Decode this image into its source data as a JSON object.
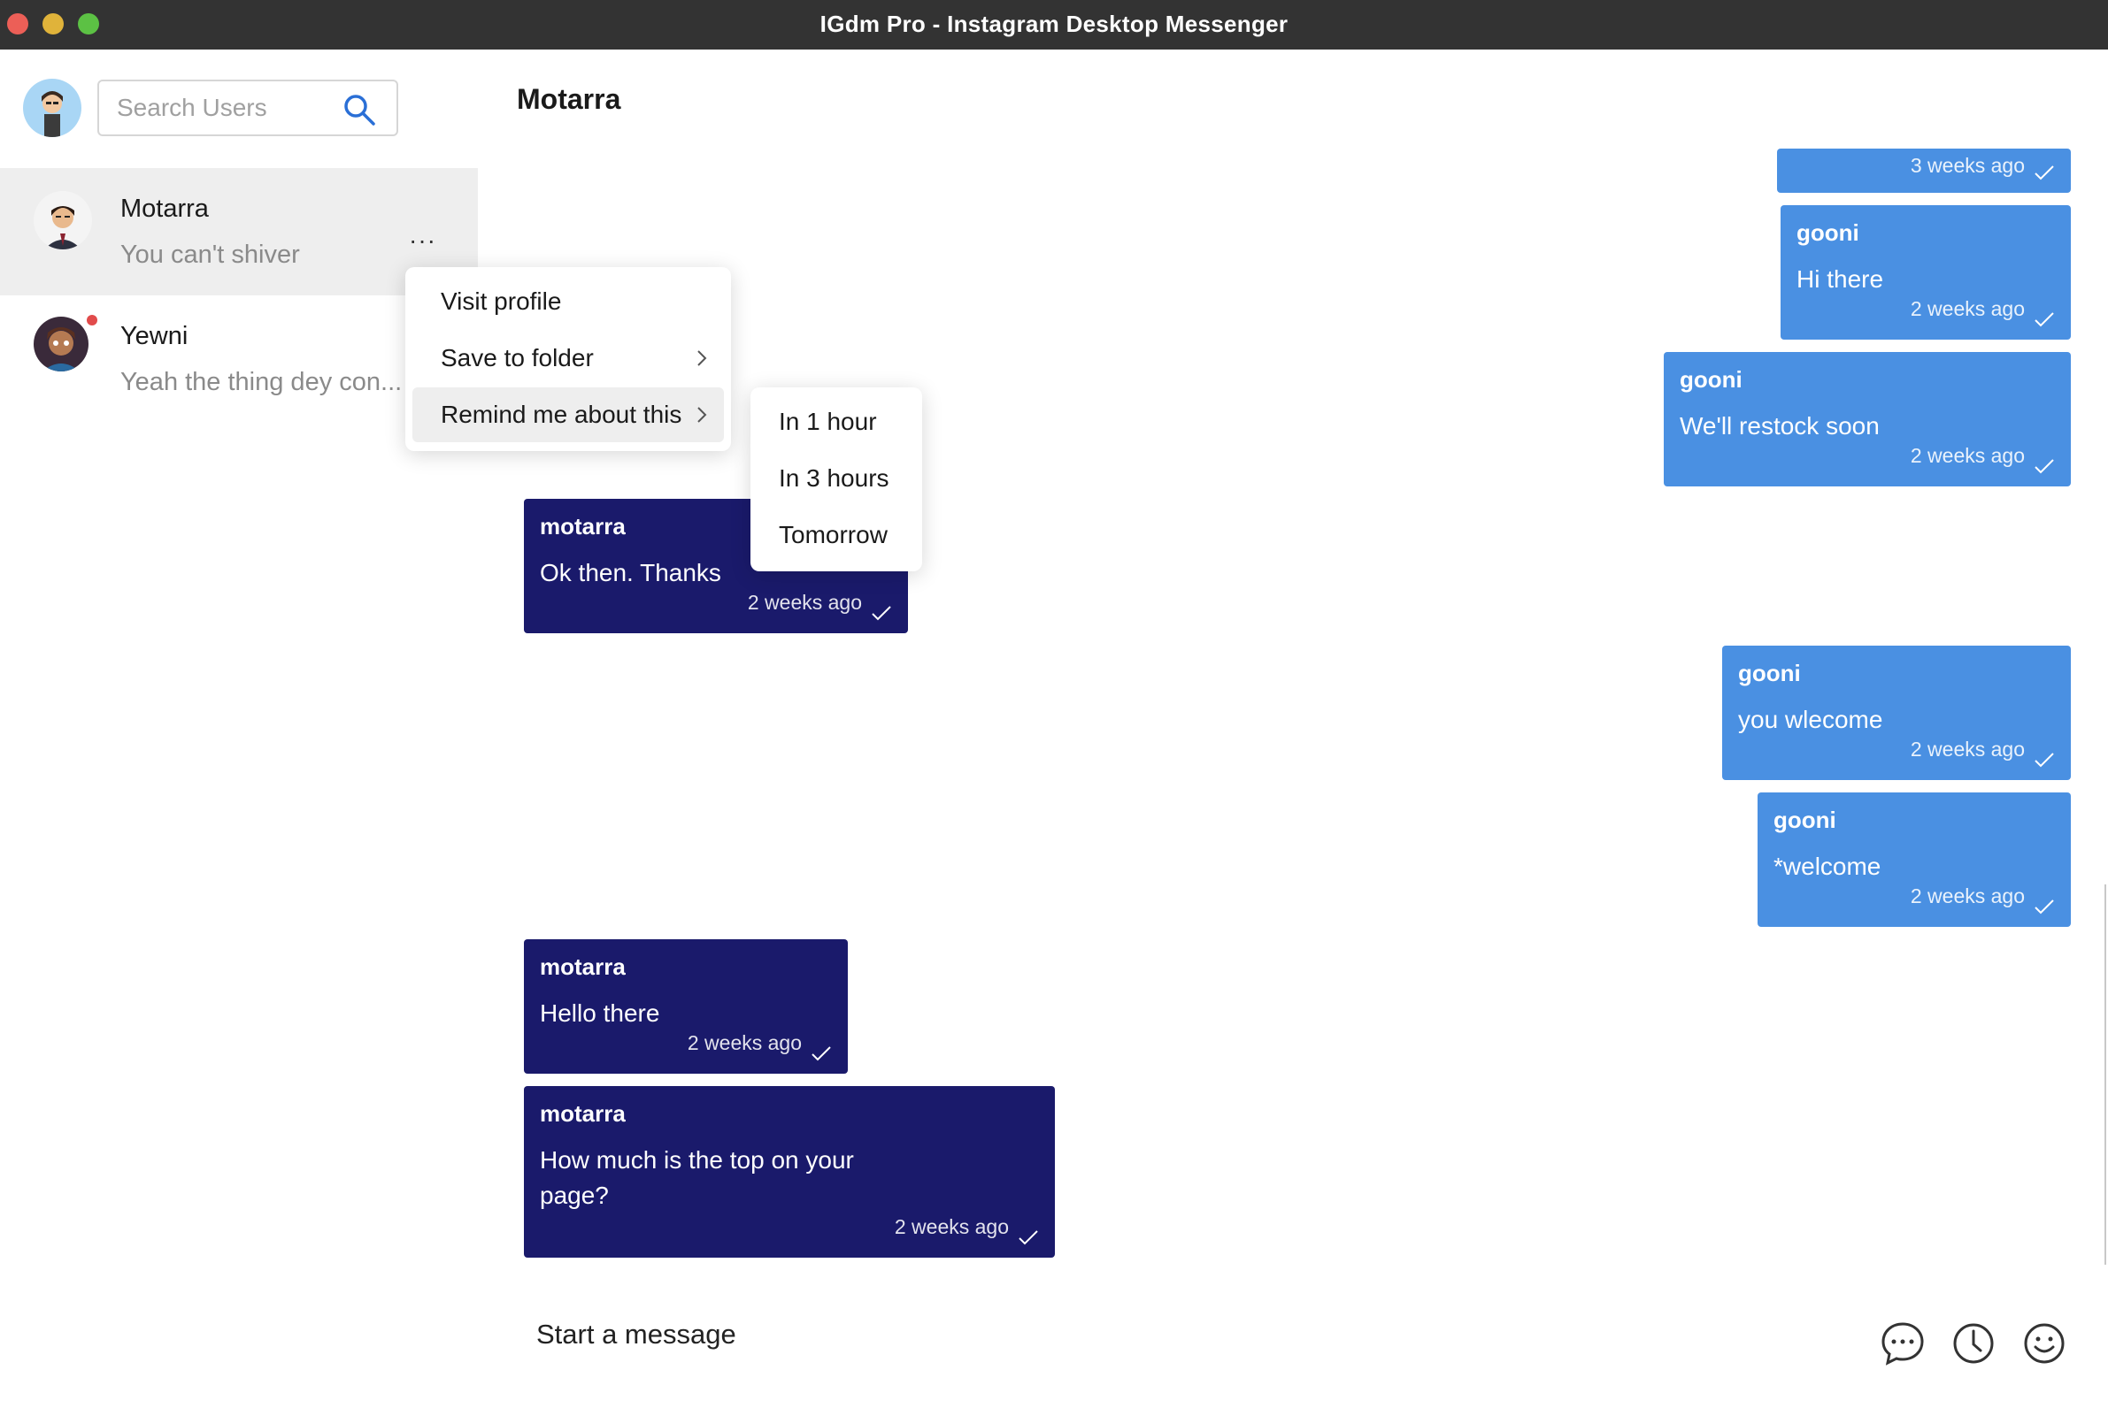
{
  "window": {
    "title": "IGdm Pro - Instagram Desktop Messenger"
  },
  "sidebar": {
    "search": {
      "placeholder": "Search Users"
    },
    "chats": [
      {
        "name": "Motarra",
        "preview": "You can't shiver"
      },
      {
        "name": "Yewni",
        "preview": "Yeah the thing dey con..."
      }
    ]
  },
  "context_menu": {
    "items": [
      "Visit profile",
      "Save to folder",
      "Remind me about this"
    ],
    "submenu": [
      "In 1 hour",
      "In 3 hours",
      "Tomorrow"
    ]
  },
  "conversation": {
    "title": "Motarra",
    "messages": [
      {
        "from": "me",
        "sender": "",
        "text": "",
        "time": "3 weeks ago"
      },
      {
        "from": "me",
        "sender": "gooni",
        "text": "Hi there",
        "time": "2 weeks ago"
      },
      {
        "from": "me",
        "sender": "gooni",
        "text": "We'll restock soon",
        "time": "2 weeks ago"
      },
      {
        "from": "them",
        "sender": "motarra",
        "text": "Ok then. Thanks",
        "time": "2 weeks ago"
      },
      {
        "from": "me",
        "sender": "gooni",
        "text": "you wlecome",
        "time": "2 weeks ago"
      },
      {
        "from": "me",
        "sender": "gooni",
        "text": "*welcome",
        "time": "2 weeks ago"
      },
      {
        "from": "them",
        "sender": "motarra",
        "text": "Hello there",
        "time": "2 weeks ago"
      },
      {
        "from": "them",
        "sender": "motarra",
        "text_lines": [
          "How much is the top on your",
          "page?"
        ],
        "time": "2 weeks ago"
      }
    ]
  },
  "composer": {
    "placeholder": "Start a message"
  },
  "colors": {
    "sent_bubble": "#4a90e2",
    "received_bubble": "#1a1a6b",
    "unread_dot": "#e14b4b"
  },
  "icons": {
    "composer": [
      "chat-bubble-icon",
      "clock-icon",
      "smiley-icon"
    ]
  }
}
